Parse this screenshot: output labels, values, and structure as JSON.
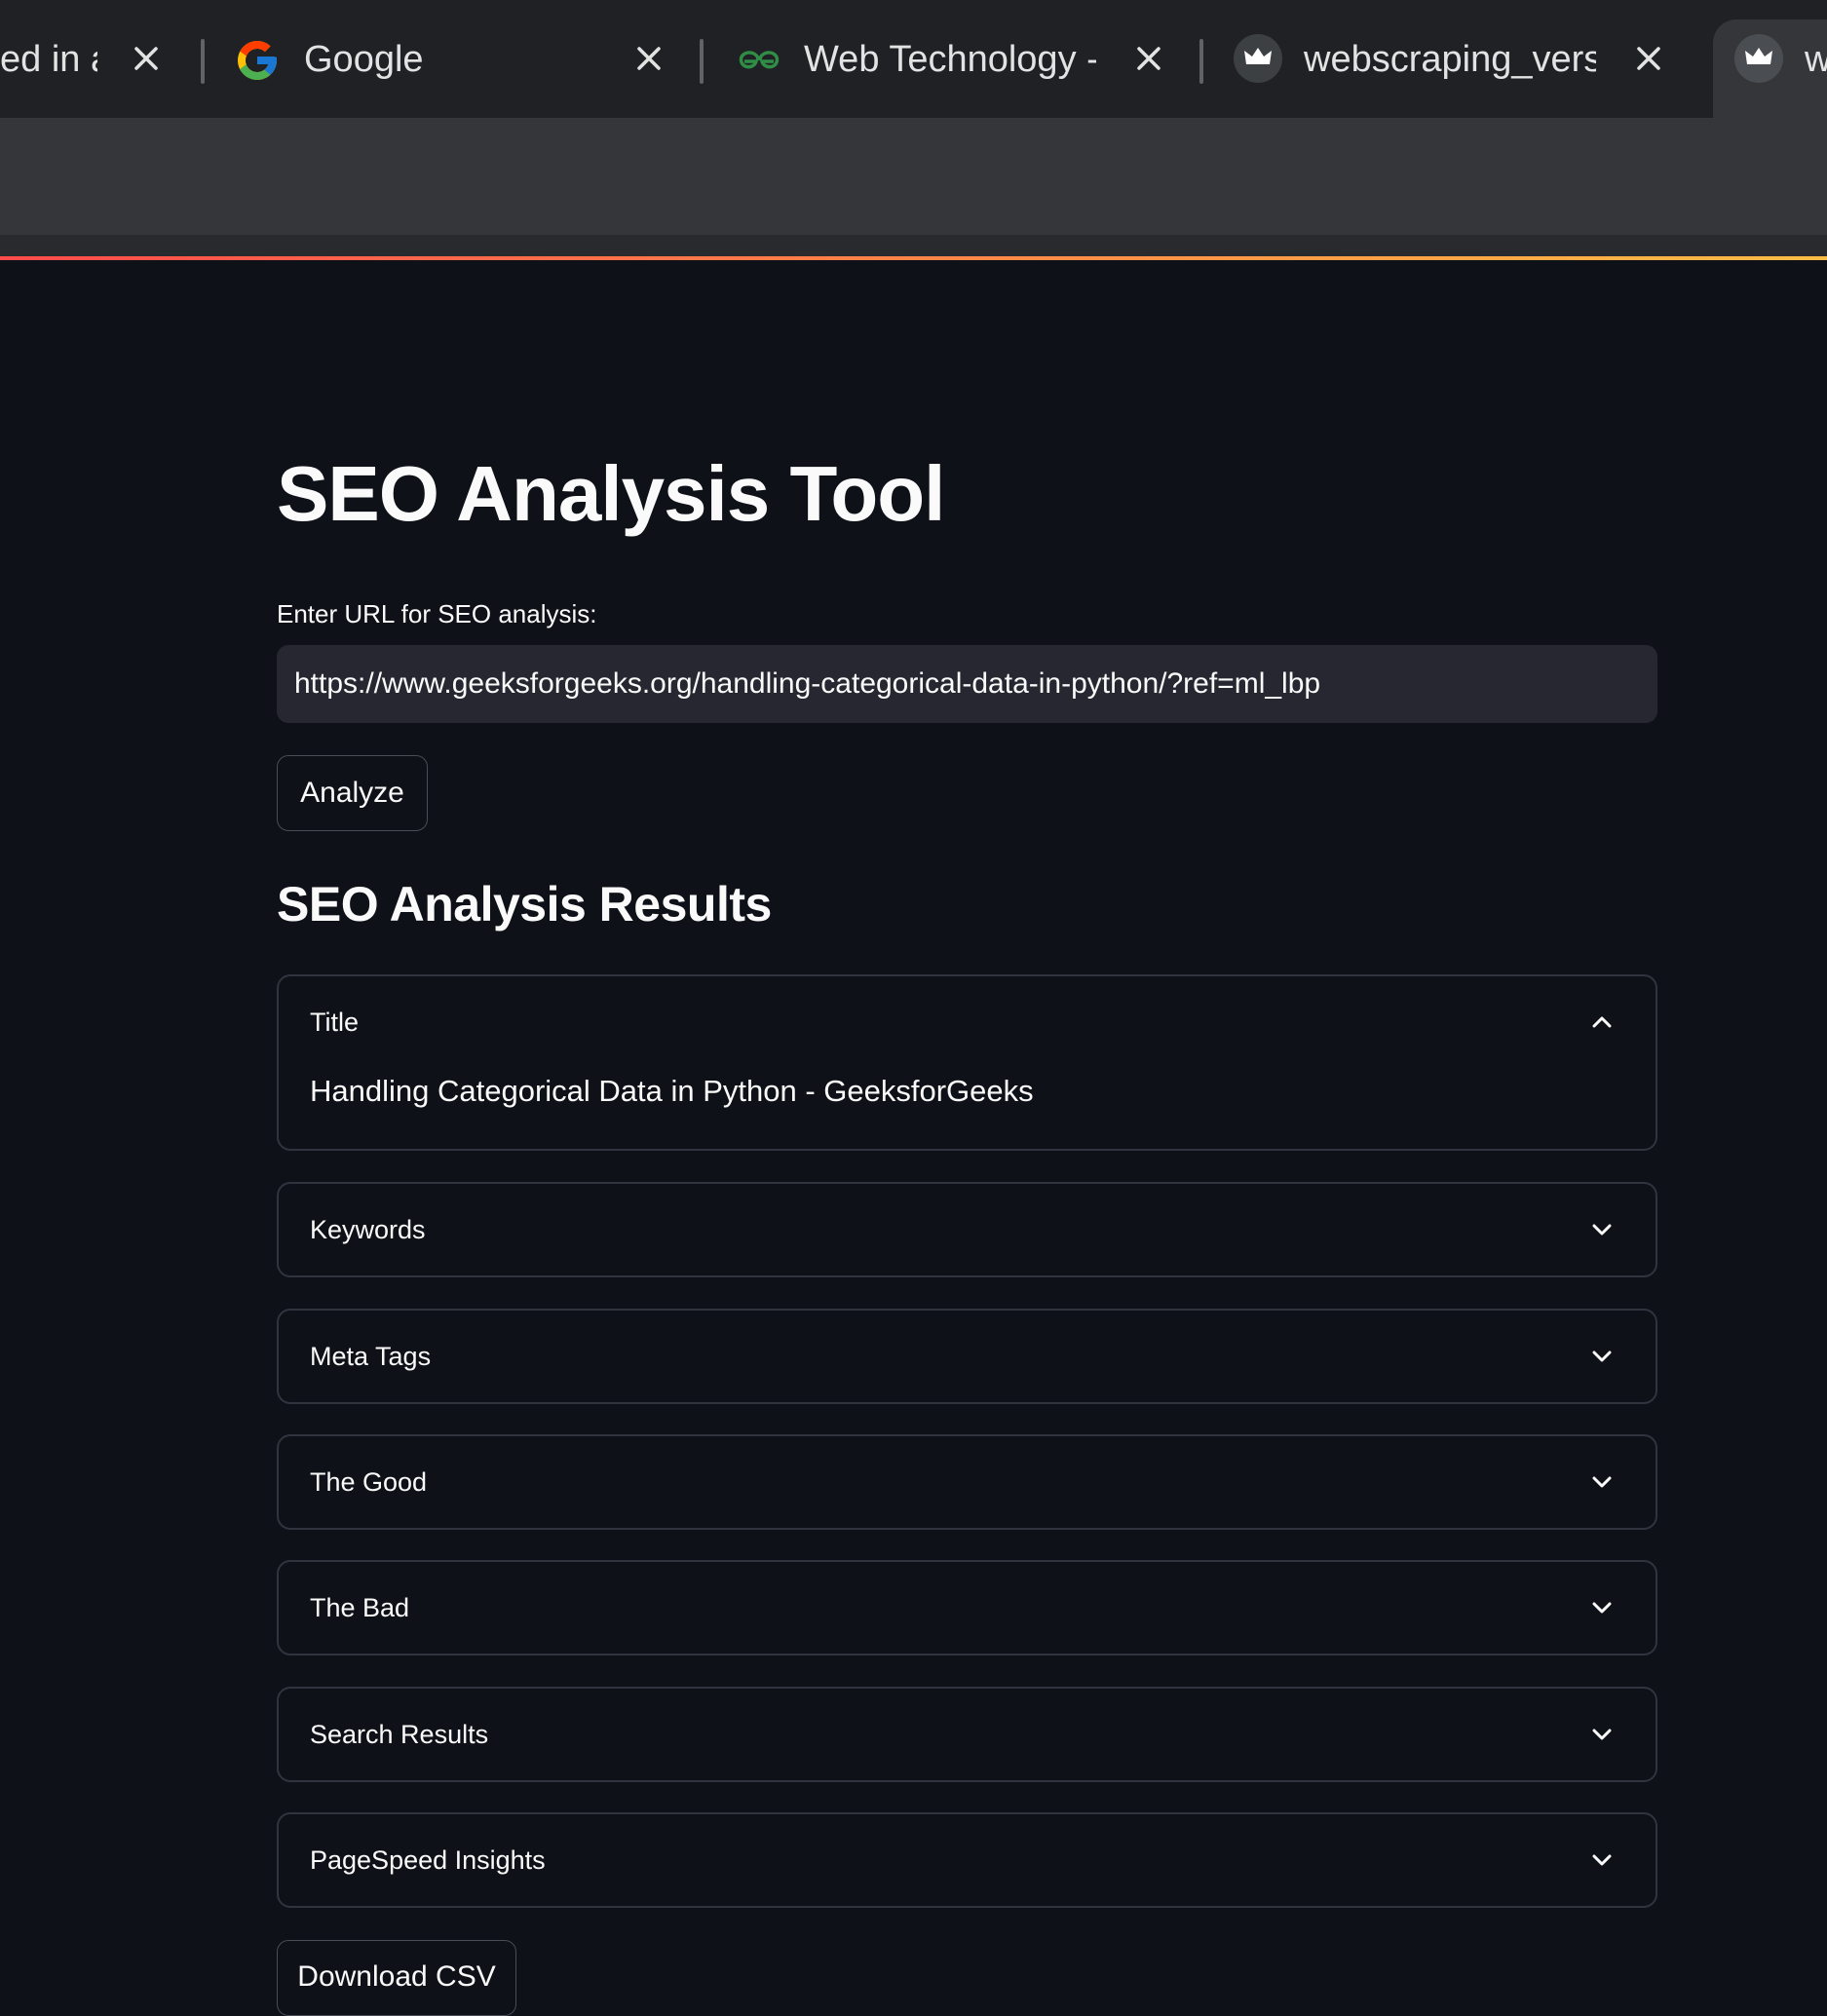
{
  "browser": {
    "tabs": [
      {
        "title": "ed in a",
        "icon": "tab-icon"
      },
      {
        "title": "Google",
        "icon": "google-icon"
      },
      {
        "title": "Web Technology -",
        "icon": "geeksforgeeks-icon"
      },
      {
        "title": "webscraping_versi",
        "icon": "streamlit-crown-icon"
      },
      {
        "title": "w",
        "icon": "streamlit-crown-icon"
      }
    ]
  },
  "app": {
    "title": "SEO Analysis Tool",
    "url_label": "Enter URL for SEO analysis:",
    "url_value": "https://www.geeksforgeeks.org/handling-categorical-data-in-python/?ref=ml_lbp",
    "analyze_label": "Analyze",
    "results_heading": "SEO Analysis Results",
    "expanders": [
      {
        "label": "Title",
        "expanded": true,
        "content": "Handling Categorical Data in Python - GeeksforGeeks"
      },
      {
        "label": "Keywords",
        "expanded": false
      },
      {
        "label": "Meta Tags",
        "expanded": false
      },
      {
        "label": "The Good",
        "expanded": false
      },
      {
        "label": "The Bad",
        "expanded": false
      },
      {
        "label": "Search Results",
        "expanded": false
      },
      {
        "label": "PageSpeed Insights",
        "expanded": false
      }
    ],
    "download_label": "Download CSV"
  },
  "colors": {
    "background": "#0e1117",
    "tabbar": "#202124",
    "toolbar": "#35363a",
    "input_bg": "#262730",
    "border": "#31333f",
    "accent_gradient_start": "#ff4b4b",
    "accent_gradient_end": "#ffbd45",
    "gfg_green": "#2f8d46"
  }
}
